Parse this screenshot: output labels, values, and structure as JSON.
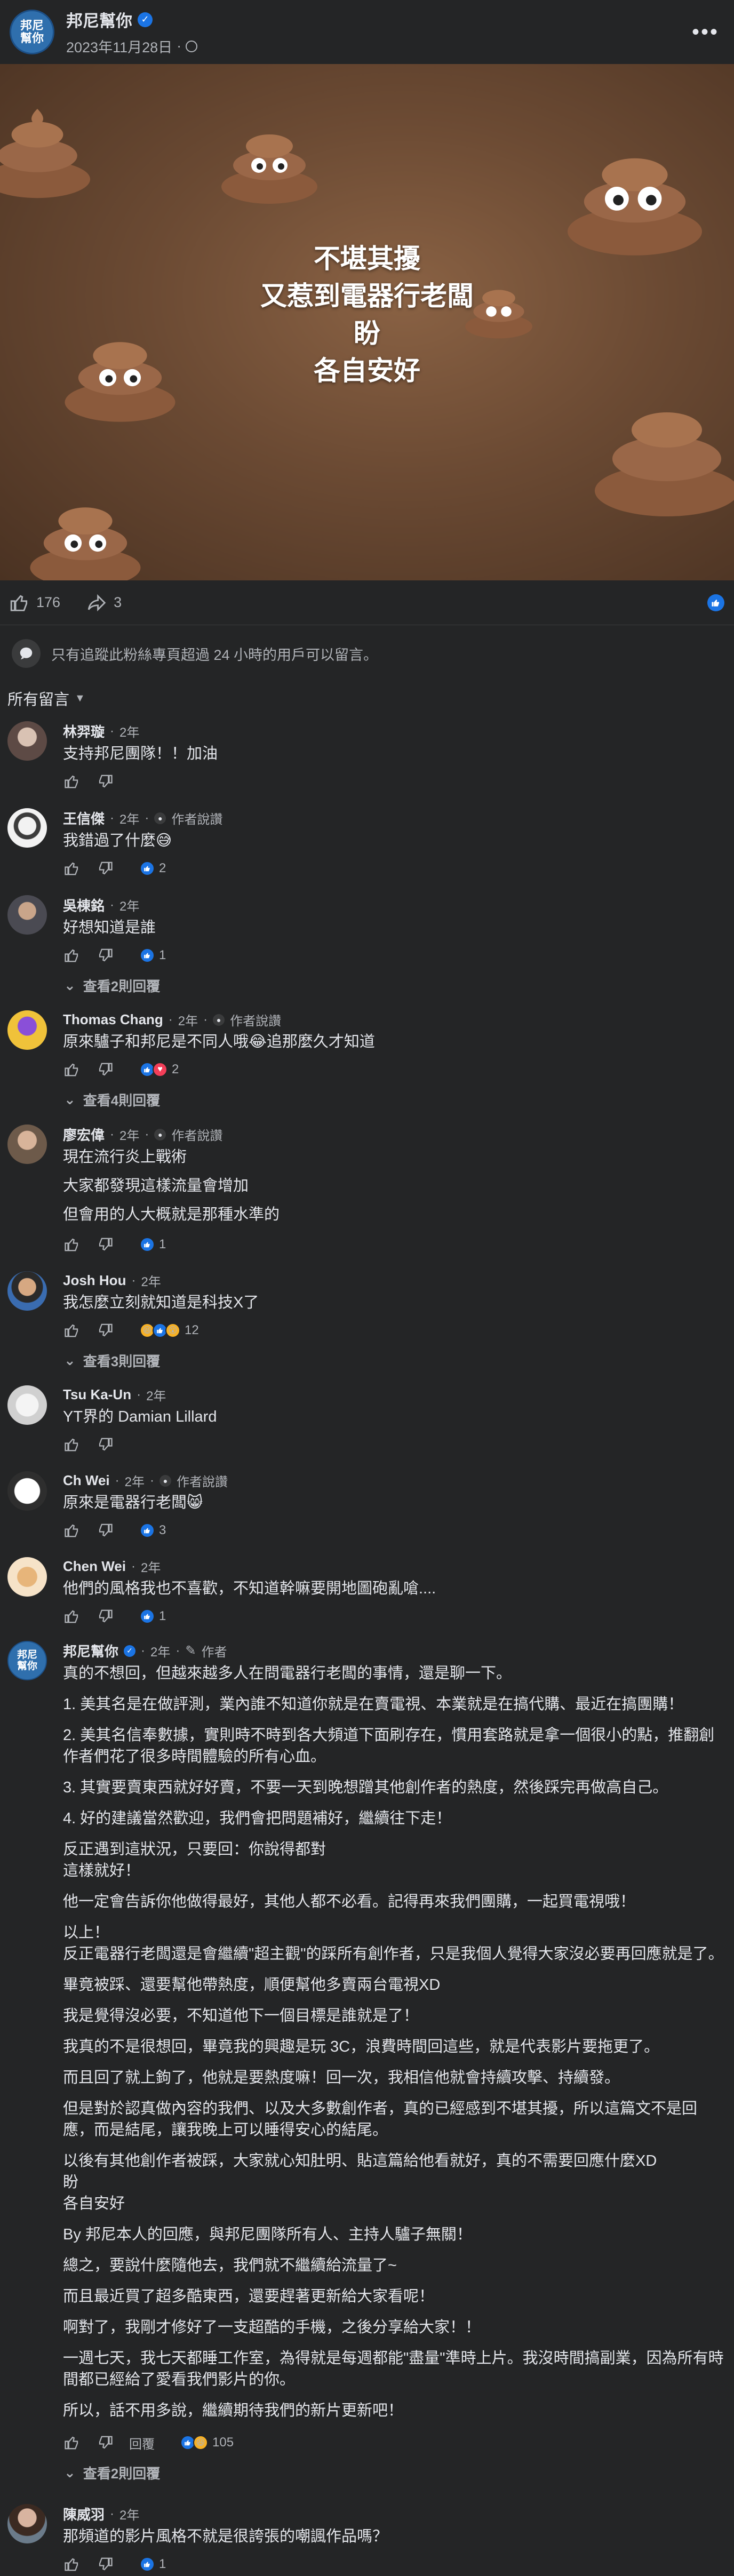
{
  "post": {
    "page_name": "邦尼幫你",
    "avatar_text_line1": "邦尼",
    "avatar_text_line2": "幫你",
    "date": "2023年11月28日",
    "more_label": "•••",
    "image_caption": [
      "不堪其擾",
      "又惹到電器行老闆",
      "盼",
      "各自安好"
    ]
  },
  "reactions": {
    "likes": "176",
    "shares": "3"
  },
  "notice": "只有追蹤此粉絲專頁超過 24 小時的用戶可以留言。",
  "filter_label": "所有留言",
  "comments": [
    {
      "name": "林羿璇",
      "time": "2年",
      "badge": "",
      "text": [
        "支持邦尼團隊！！加油"
      ],
      "count": "",
      "react": "",
      "replies": ""
    },
    {
      "name": "王信傑",
      "time": "2年",
      "badge": "作者說讚",
      "text": [
        "我錯過了什麼😅"
      ],
      "count": "2",
      "react": "like",
      "replies": ""
    },
    {
      "name": "吳棟銘",
      "time": "2年",
      "badge": "",
      "text": [
        "好想知道是誰"
      ],
      "count": "1",
      "react": "like",
      "replies": "查看2則回覆"
    },
    {
      "name": "Thomas Chang",
      "time": "2年",
      "badge": "作者說讚",
      "text": [
        "原來驢子和邦尼是不同人哦😂追那麼久才知道"
      ],
      "count": "2",
      "react": "like-love",
      "replies": "查看4則回覆"
    },
    {
      "name": "廖宏偉",
      "time": "2年",
      "badge": "作者說讚",
      "text": [
        "現在流行炎上戰術",
        "大家都發現這樣流量會增加",
        "但會用的人大概就是那種水準的"
      ],
      "count": "1",
      "react": "like",
      "replies": ""
    },
    {
      "name": "Josh Hou",
      "time": "2年",
      "badge": "",
      "text": [
        "我怎麼立刻就知道是科技X了"
      ],
      "count": "12",
      "react": "haha-like-wow",
      "replies": "查看3則回覆"
    },
    {
      "name": "Tsu Ka-Un",
      "time": "2年",
      "badge": "",
      "text": [
        "YT界的 Damian Lillard"
      ],
      "count": "",
      "react": "",
      "replies": ""
    },
    {
      "name": "Ch Wei",
      "time": "2年",
      "badge": "作者說讚",
      "text": [
        "原來是電器行老闆😸"
      ],
      "count": "3",
      "react": "like",
      "replies": ""
    },
    {
      "name": "Chen Wei",
      "time": "2年",
      "badge": "",
      "text": [
        "他們的風格我也不喜歡，不知道幹嘛要開地圖砲亂嗆...."
      ],
      "count": "1",
      "react": "like",
      "replies": ""
    }
  ],
  "author_comment": {
    "name": "邦尼幫你",
    "time": "2年",
    "badge": "作者",
    "paragraphs": [
      "真的不想回，但越來越多人在問電器行老闆的事情，還是聊一下。",
      "1. 美其名是在做評測，業內誰不知道你就是在賣電視、本業就是在搞代購、最近在搞團購！",
      "2. 美其名信奉數據，實則時不時到各大頻道下面刷存在，慣用套路就是拿一個很小的點，推翻創作者們花了很多時間體驗的所有心血。",
      "3. 其實要賣東西就好好賣，不要一天到晚想蹭其他創作者的熱度，然後踩完再做高自己。",
      "4. 好的建議當然歡迎，我們會把問題補好，繼續往下走！",
      "反正遇到這狀況，只要回：你說得都對\n這樣就好！",
      "他一定會告訴你他做得最好，其他人都不必看。記得再來我們團購，一起買電視哦！",
      "以上！\n反正電器行老闆還是會繼續\"超主觀\"的踩所有創作者，只是我個人覺得大家沒必要再回應就是了。",
      "畢竟被踩、還要幫他帶熱度，順便幫他多賣兩台電視XD",
      "我是覺得沒必要，不知道他下一個目標是誰就是了！",
      "我真的不是很想回，畢竟我的興趣是玩 3C，浪費時間回這些，就是代表影片要拖更了。",
      "而且回了就上鉤了，他就是要熱度嘛！回一次，我相信他就會持續攻擊、持續發。",
      "但是對於認真做內容的我們、以及大多數創作者，真的已經感到不堪其擾，所以這篇文不是回應，而是結尾，讓我晚上可以睡得安心的結尾。",
      "以後有其他創作者被踩，大家就心知肚明、貼這篇給他看就好，真的不需要回應什麼XD\n盼\n各自安好",
      "By 邦尼本人的回應，與邦尼團隊所有人、主持人驢子無關！",
      "總之，要說什麼隨他去，我們就不繼續給流量了~",
      "而且最近買了超多酷東西，還要趕著更新給大家看呢！",
      "啊對了，我剛才修好了一支超酷的手機，之後分享給大家！！",
      "一週七天，我七天都睡工作室，為得就是每週都能\"盡量\"準時上片。我沒時間搞副業，因為所有時間都已經給了愛看我們影片的你。",
      "所以，話不用多說，繼續期待我們的新片更新吧！"
    ],
    "reply_label": "回覆",
    "count": "105",
    "replies": "查看2則回覆"
  },
  "last_comment": {
    "name": "陳威羽",
    "time": "2年",
    "text": "那頻道的影片風格不就是很誇張的嘲諷作品嗎？",
    "count": "1"
  },
  "colors": {
    "background": "#242526",
    "text": "#e4e6eb",
    "secondary": "#b0b3b8",
    "accent": "#1b74e4"
  }
}
